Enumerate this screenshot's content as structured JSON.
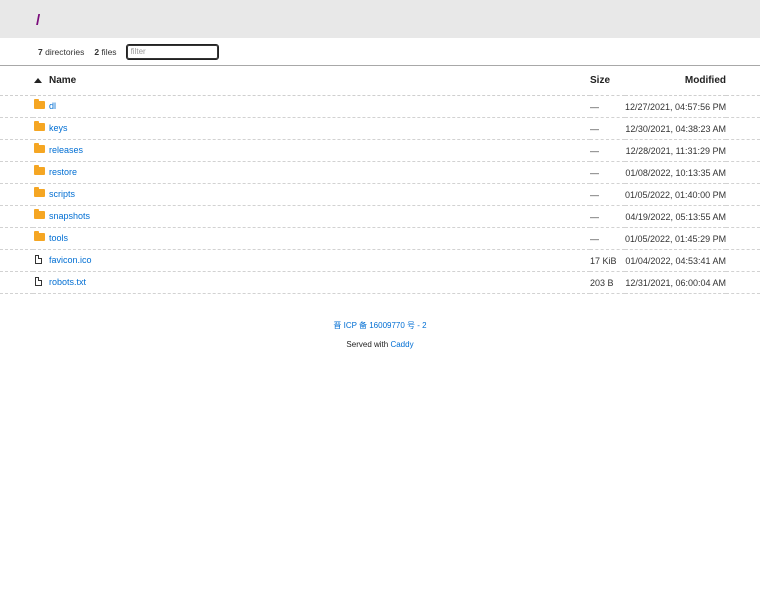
{
  "header": {
    "path": "/"
  },
  "summary": {
    "dir_count": "7",
    "dir_label": "directories",
    "file_count": "2",
    "file_label": "files",
    "filter_placeholder": "filter"
  },
  "columns": {
    "name": "Name",
    "size": "Size",
    "modified": "Modified"
  },
  "rows": [
    {
      "name": "dl",
      "type": "folder",
      "size": "—",
      "modified": "12/27/2021, 04:57:56 PM"
    },
    {
      "name": "keys",
      "type": "folder",
      "size": "—",
      "modified": "12/30/2021, 04:38:23 AM"
    },
    {
      "name": "releases",
      "type": "folder",
      "size": "—",
      "modified": "12/28/2021, 11:31:29 PM"
    },
    {
      "name": "restore",
      "type": "folder",
      "size": "—",
      "modified": "01/08/2022, 10:13:35 AM"
    },
    {
      "name": "scripts",
      "type": "folder",
      "size": "—",
      "modified": "01/05/2022, 01:40:00 PM"
    },
    {
      "name": "snapshots",
      "type": "folder",
      "size": "—",
      "modified": "04/19/2022, 05:13:55 AM"
    },
    {
      "name": "tools",
      "type": "folder",
      "size": "—",
      "modified": "01/05/2022, 01:45:29 PM"
    },
    {
      "name": "favicon.ico",
      "type": "file",
      "size": "17 KiB",
      "modified": "01/04/2022, 04:53:41 AM"
    },
    {
      "name": "robots.txt",
      "type": "file",
      "size": "203 B",
      "modified": "12/31/2021, 06:00:04 AM"
    }
  ],
  "footer": {
    "icp": "晋 ICP 备 16009770 号 - 2",
    "served_with": "Served with",
    "caddy": "Caddy"
  },
  "colors": {
    "link": "#006ed3",
    "path": "#7b0c7b",
    "folder": "#f5a623",
    "header_bg": "#e8e8e8"
  },
  "icons": {
    "folder": "folder-icon",
    "file": "file-icon",
    "sort": "sort-asc-icon"
  }
}
